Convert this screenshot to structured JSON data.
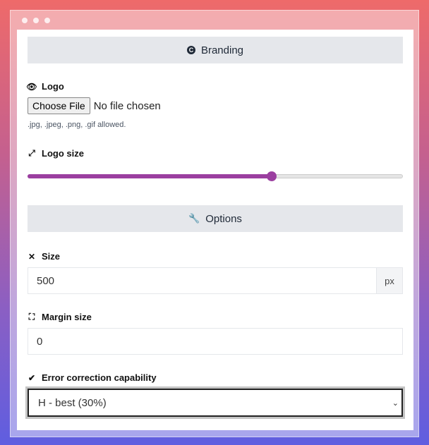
{
  "branding": {
    "title": "Branding",
    "icon": "copyright-icon"
  },
  "logo": {
    "label": "Logo",
    "icon": "eye-icon",
    "button": "Choose File",
    "status": "No file chosen",
    "hint": ".jpg, .jpeg, .png, .gif allowed."
  },
  "logo_size": {
    "label": "Logo size",
    "icon": "expand-arrows-icon",
    "value_percent": 65,
    "color": "#9b3fa0"
  },
  "options": {
    "title": "Options",
    "icon": "wrench-icon"
  },
  "size": {
    "label": "Size",
    "value": "500",
    "unit": "px"
  },
  "margin": {
    "label": "Margin size",
    "value": "0"
  },
  "error_correction": {
    "label": "Error correction capability",
    "selected": "H - best (30%)"
  }
}
